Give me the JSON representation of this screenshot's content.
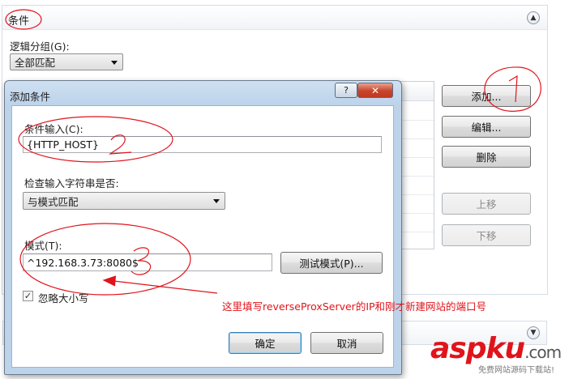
{
  "section": {
    "title": "条件",
    "group_label": "逻辑分组(G):",
    "group_value": "全部匹配",
    "buttons": {
      "add": "添加...",
      "edit": "编辑...",
      "delete": "删除",
      "move_up": "上移",
      "move_down": "下移"
    }
  },
  "dialog": {
    "title": "添加条件",
    "help_label": "?",
    "close_label": "✕",
    "condition_input_label": "条件输入(C):",
    "condition_input_value": "{HTTP_HOST}",
    "check_label": "检查输入字符串是否:",
    "check_value": "与模式匹配",
    "pattern_label": "模式(T):",
    "pattern_value": "^192.168.3.73:8080$",
    "test_button": "测试模式(P)...",
    "ignore_case_label": "忽略大小写",
    "ignore_case_checked": true,
    "ok_button": "确定",
    "cancel_button": "取消"
  },
  "annotations": {
    "note": "这里填写reverseProxServer的IP和刚才新建网站的端口号",
    "numbers": [
      "1",
      "2",
      "3"
    ],
    "color": "#e0141b"
  },
  "watermark": {
    "main": "aspku",
    "suffix": ".com",
    "tagline": "免费网站源码下载站!"
  },
  "icons": {
    "collapse_up": "chevron-up-icon",
    "collapse_down": "chevron-down-icon",
    "dropdown": "chevron-down-icon",
    "check": "checkmark-icon"
  }
}
